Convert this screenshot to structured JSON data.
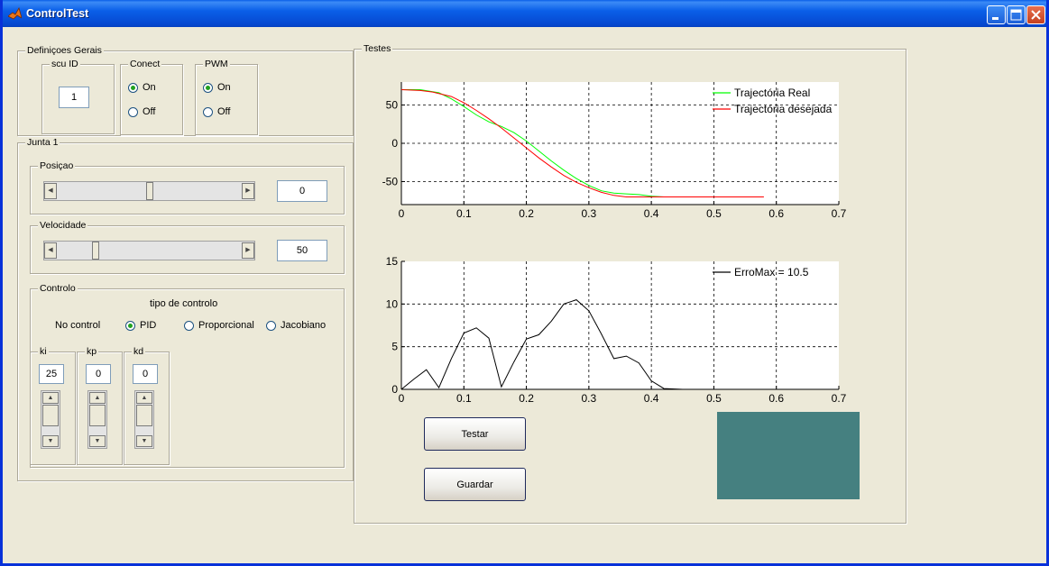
{
  "window": {
    "title": "ControlTest",
    "controls": [
      "minimize-icon",
      "maximize-icon",
      "close-icon"
    ]
  },
  "definicoes": {
    "label": "Definiçoes Gerais",
    "scu": {
      "label": "scu ID",
      "value": "1"
    },
    "conect": {
      "label": "Conect",
      "on_label": "On",
      "off_label": "Off",
      "selected": "On"
    },
    "pwm": {
      "label": "PWM",
      "on_label": "On",
      "off_label": "Off",
      "selected": "On"
    }
  },
  "junta": {
    "label": "Junta 1",
    "posicao": {
      "label": "Posiçao",
      "value": "0",
      "level": 0.5
    },
    "velocidade": {
      "label": "Velocidade",
      "value": "50",
      "level": 0.2
    },
    "controlo": {
      "label": "Controlo",
      "tipo_label": "tipo de controlo",
      "no_control": "No control",
      "options": [
        "PID",
        "Proporcional",
        "Jacobiano"
      ],
      "selected": "PID",
      "ki": {
        "label": "ki",
        "value": "25"
      },
      "kp": {
        "label": "kp",
        "value": "0"
      },
      "kd": {
        "label": "kd",
        "value": "0"
      }
    }
  },
  "testes": {
    "label": "Testes",
    "testar_label": "Testar",
    "guardar_label": "Guardar",
    "indicator_color": "#458080"
  },
  "chart_data": [
    {
      "type": "line",
      "xlim": [
        0,
        0.7
      ],
      "ylim": [
        -80,
        80
      ],
      "xticks": [
        "0",
        "0.1",
        "0.2",
        "0.3",
        "0.4",
        "0.5",
        "0.6",
        "0.7"
      ],
      "yticks": [
        "50",
        "0",
        "-50"
      ],
      "grid": true,
      "legend_position": "top-right",
      "series": [
        {
          "name": "Trajectória Real",
          "color": "#00ff00",
          "x": [
            0,
            0.03,
            0.06,
            0.08,
            0.1,
            0.12,
            0.14,
            0.16,
            0.18,
            0.2,
            0.22,
            0.24,
            0.26,
            0.28,
            0.3,
            0.32,
            0.34,
            0.36,
            0.38,
            0.4,
            0.42
          ],
          "y": [
            70,
            70,
            66,
            58,
            48,
            37,
            28,
            22,
            14,
            3,
            -10,
            -23,
            -35,
            -46,
            -55,
            -62,
            -65,
            -66,
            -67,
            -69,
            -70
          ]
        },
        {
          "name": "Trajectória desejada",
          "color": "#ff0000",
          "x": [
            0,
            0.03,
            0.05,
            0.08,
            0.1,
            0.12,
            0.14,
            0.16,
            0.18,
            0.2,
            0.22,
            0.24,
            0.26,
            0.28,
            0.3,
            0.32,
            0.34,
            0.36,
            0.38,
            0.42,
            0.5,
            0.58
          ],
          "y": [
            70,
            69,
            67,
            61,
            53,
            43,
            32,
            20,
            7,
            -6,
            -19,
            -31,
            -42,
            -51,
            -58,
            -64,
            -68,
            -70,
            -70,
            -70,
            -70,
            -70
          ]
        }
      ]
    },
    {
      "type": "line",
      "xlim": [
        0,
        0.7
      ],
      "ylim": [
        0,
        15
      ],
      "xticks": [
        "0",
        "0.1",
        "0.2",
        "0.3",
        "0.4",
        "0.5",
        "0.6",
        "0.7"
      ],
      "yticks": [
        "15",
        "10",
        "5",
        "0"
      ],
      "grid": true,
      "legend_position": "top-right",
      "series": [
        {
          "name": "ErroMax = 10.5",
          "color": "#000000",
          "x": [
            0,
            0.02,
            0.04,
            0.06,
            0.08,
            0.1,
            0.12,
            0.14,
            0.16,
            0.18,
            0.2,
            0.22,
            0.24,
            0.26,
            0.28,
            0.3,
            0.32,
            0.34,
            0.36,
            0.38,
            0.4,
            0.42,
            0.45,
            0.5,
            0.58
          ],
          "y": [
            0,
            1.2,
            2.3,
            0.2,
            3.6,
            6.6,
            7.2,
            6.0,
            0.3,
            3.2,
            5.9,
            6.4,
            8.0,
            10.0,
            10.5,
            9.2,
            6.5,
            3.6,
            3.9,
            3.1,
            1.0,
            0.1,
            0,
            0,
            0
          ]
        }
      ]
    }
  ]
}
